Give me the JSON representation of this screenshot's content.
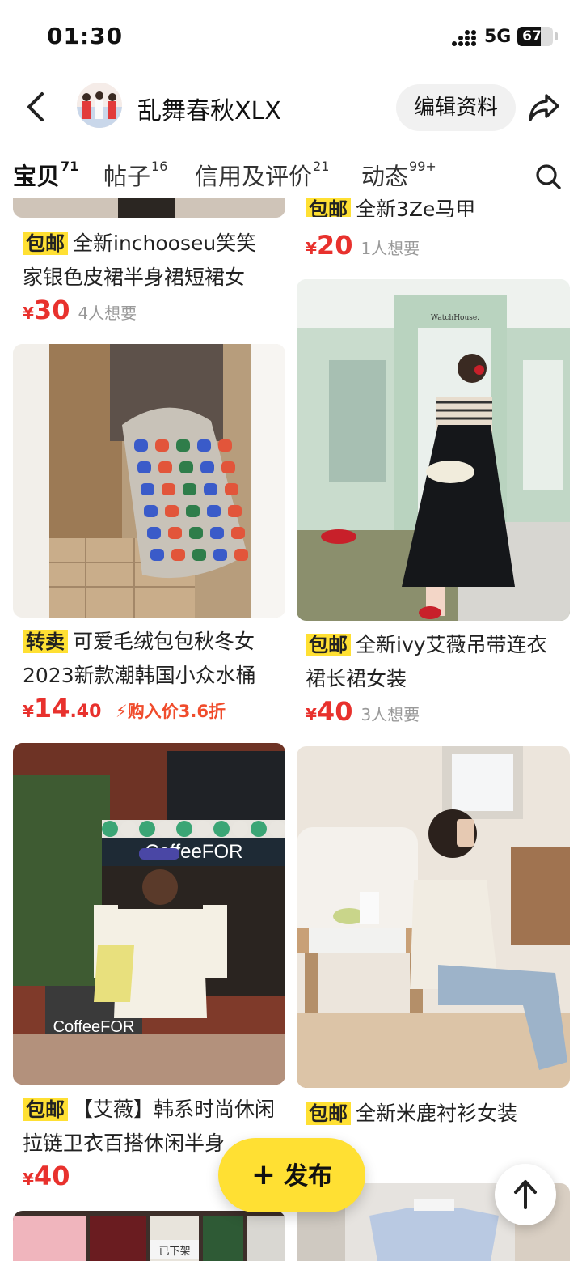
{
  "status_bar": {
    "time": "01:30",
    "network": "5G",
    "battery": "67",
    "battery_level": 0.67
  },
  "header": {
    "shop_name": "乱舞春秋XLX",
    "edit_label": "编辑资料"
  },
  "tabs": [
    {
      "label": "宝贝",
      "count": "71"
    },
    {
      "label": "帖子",
      "count": "16"
    },
    {
      "label": "信用及评价",
      "count": "21"
    },
    {
      "label": "动态",
      "count": "99+"
    }
  ],
  "items": {
    "top_right_partial": {
      "tag": "包邮",
      "title": "全新3Ze马甲",
      "price": "20",
      "wants": "1人想要"
    },
    "left1": {
      "tag": "包邮",
      "title": "全新inchooseu笑笑家银色皮裙半身裙短裙女",
      "price": "30",
      "wants": "4人想要"
    },
    "left2": {
      "tag": "转卖",
      "title": "可爱毛绒包包秋冬女2023新款潮韩国小众水桶",
      "price_int": "14",
      "price_dec": ".40",
      "promo": "购入价3.6折"
    },
    "right2": {
      "tag": "包邮",
      "title": "全新ivy艾薇吊带连衣裙长裙女装",
      "price": "40",
      "wants": "3人想要"
    },
    "left3": {
      "tag": "包邮",
      "title": "【艾薇】韩系时尚休闲拉链卫衣百搭休闲半身",
      "price": "40"
    },
    "right3": {
      "tag": "包邮",
      "title": "全新米鹿衬衫女装"
    }
  },
  "image_text": {
    "cafe_sign": "CoffeeFOR",
    "shop_sign": "WatchHouse.",
    "removed_label": "已下架"
  },
  "fab": {
    "label": "发布",
    "plus": "+"
  },
  "colors": {
    "accent": "#ffe033",
    "price": "#e8312d"
  }
}
